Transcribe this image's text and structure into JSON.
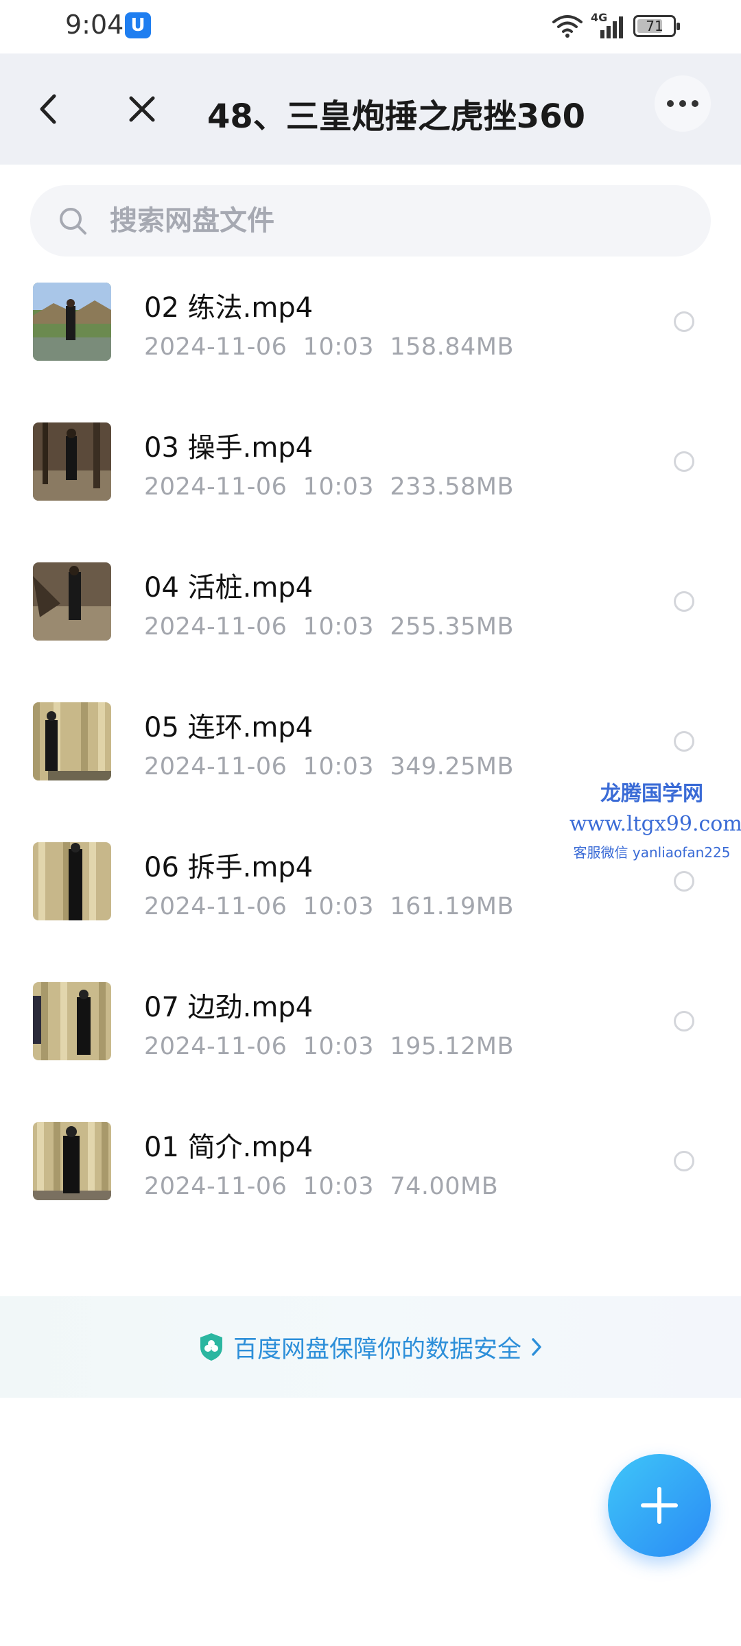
{
  "status_bar": {
    "time": "9:04",
    "app_icon_glyph": "U",
    "network": "4G",
    "battery_percent": "71",
    "battery_level": 0.71
  },
  "header": {
    "title": "48、三皇炮捶之虎挫360",
    "back_icon": "chevron-left-icon",
    "close_icon": "close-icon",
    "more_icon": "more-horizontal-icon"
  },
  "search": {
    "placeholder": "搜索网盘文件",
    "value": ""
  },
  "files": [
    {
      "name": "02 练法.mp4",
      "date": "2024-11-06",
      "time": "10:03",
      "size": "158.84MB"
    },
    {
      "name": "03 操手.mp4",
      "date": "2024-11-06",
      "time": "10:03",
      "size": "233.58MB"
    },
    {
      "name": "04 活桩.mp4",
      "date": "2024-11-06",
      "time": "10:03",
      "size": "255.35MB"
    },
    {
      "name": "05 连环.mp4",
      "date": "2024-11-06",
      "time": "10:03",
      "size": "349.25MB"
    },
    {
      "name": "06 拆手.mp4",
      "date": "2024-11-06",
      "time": "10:03",
      "size": "161.19MB"
    },
    {
      "name": "07 边劲.mp4",
      "date": "2024-11-06",
      "time": "10:03",
      "size": "195.12MB"
    },
    {
      "name": "01 简介.mp4",
      "date": "2024-11-06",
      "time": "10:03",
      "size": "74.00MB"
    }
  ],
  "watermark": {
    "line1": "龙腾国学网",
    "line2": "www.ltgx99.com",
    "line3": "客服微信 yanliaofan225"
  },
  "security_banner": {
    "text": "百度网盘保障你的数据安全",
    "icon": "shield-icon",
    "arrow_icon": "chevron-right-icon"
  },
  "fab": {
    "icon": "plus-icon"
  },
  "colors": {
    "accent": "#2d8fd9",
    "fab_start": "#3fc6f8",
    "fab_end": "#2a8af5",
    "header_bg": "#eef0f5"
  }
}
